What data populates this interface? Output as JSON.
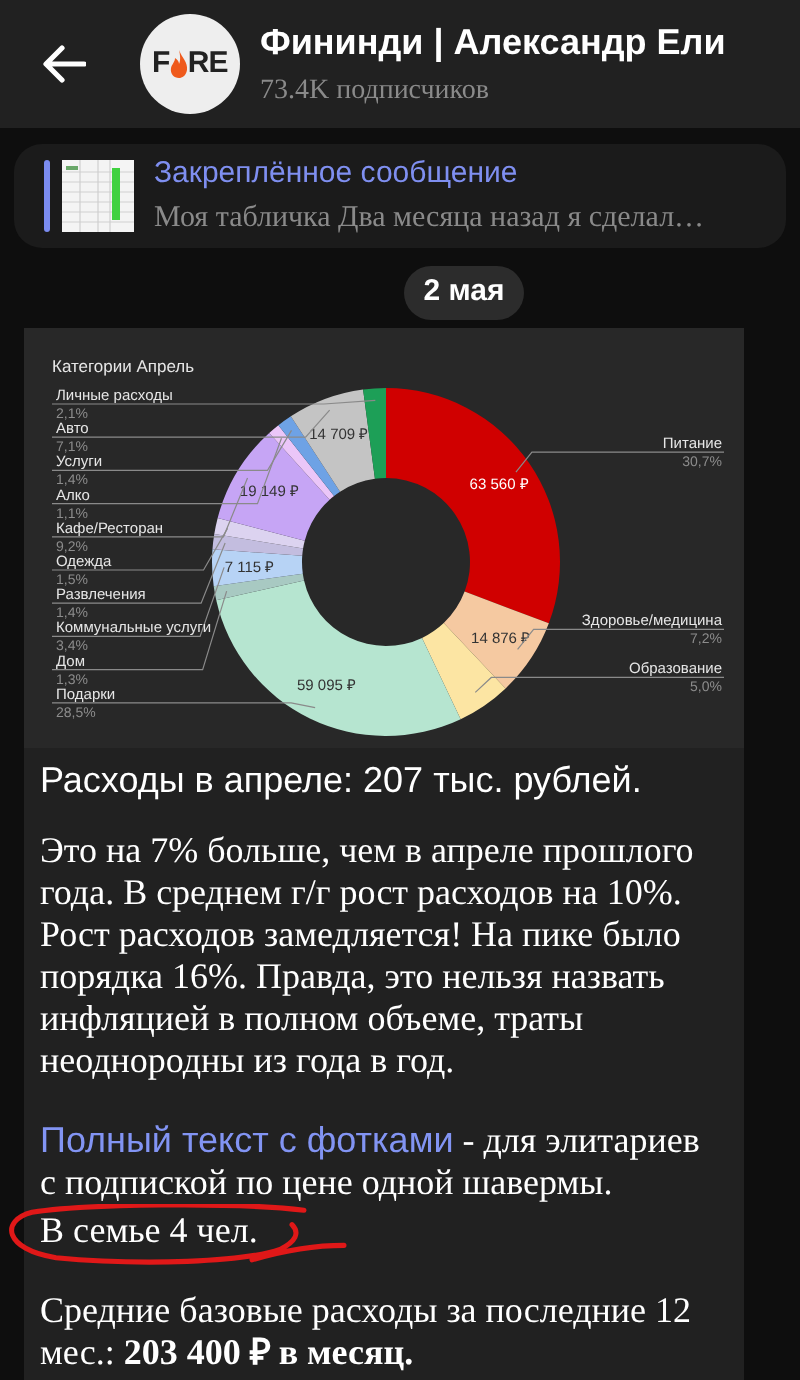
{
  "header": {
    "title": "Фининди | Александр Ели",
    "subtitle": "73.4K подписчиков",
    "avatar": {
      "logo_left": "F",
      "logo_right": "RE"
    }
  },
  "pinned": {
    "title": "Закреплённое сообщение",
    "preview": "Моя табличка  Два месяца назад я сделал…"
  },
  "date": "2 мая",
  "message": {
    "chart_data": {
      "type": "donut",
      "title": "Категории Апрель",
      "categories": [
        "Питание",
        "Здоровье/медицина",
        "Образование",
        "Подарки",
        "Дом",
        "Коммунальные услуги",
        "Развлечения",
        "Одежда",
        "Кафе/Ресторан",
        "Алко",
        "Услуги",
        "Авто",
        "Личные расходы"
      ],
      "values": [
        30.7,
        7.2,
        5.0,
        28.5,
        1.3,
        3.4,
        1.4,
        1.5,
        9.2,
        1.1,
        1.4,
        7.1,
        2.1
      ],
      "colors": [
        "#d00000",
        "#f5c9a1",
        "#fce5a3",
        "#b6e5d0",
        "#a8c9c2",
        "#b7d3f5",
        "#c3bddf",
        "#dcd3f0",
        "#c6a5f5",
        "#ebc6f8",
        "#6ea2e5",
        "#c4c4c4",
        "#1d9f57"
      ],
      "value_labels": [
        "30,7%",
        "7,2%",
        "5,0%",
        "28,5%",
        "1,3%",
        "3,4%",
        "1,4%",
        "1,5%",
        "9,2%",
        "1,1%",
        "1,4%",
        "7,1%",
        "2,1%"
      ],
      "annotations": [
        {
          "x": "Питание",
          "text": "63 560 ₽"
        },
        {
          "x": "Здоровье/медицина",
          "text": "14 876 ₽"
        },
        {
          "x": "Подарки",
          "text": "59 095 ₽"
        },
        {
          "x": "Коммунальные услуги",
          "text": "7 115 ₽"
        },
        {
          "x": "Кафе/Ресторан",
          "text": "19 149 ₽"
        },
        {
          "x": "Авто",
          "text": "14 709 ₽"
        }
      ]
    },
    "heading": "Расходы в апреле: 207 тыс. рублей.",
    "paragraph": "Это на 7% больше, чем в апреле прошлого года. В среднем г/г рост расходов на 10%. Рост расходов замедляется! На пике было порядка 16%. Правда, это нельзя назвать инфляцией в полном объеме, траты неоднородны из года в год.",
    "link": "Полный текст с фотками",
    "link_rest": " - для элитариев с подпиской по цене одной шавермы.",
    "family": "В семье 4 чел.",
    "average": "Средние базовые расходы за последние 12 мес.: **203 400 ₽ в месяц.**"
  }
}
